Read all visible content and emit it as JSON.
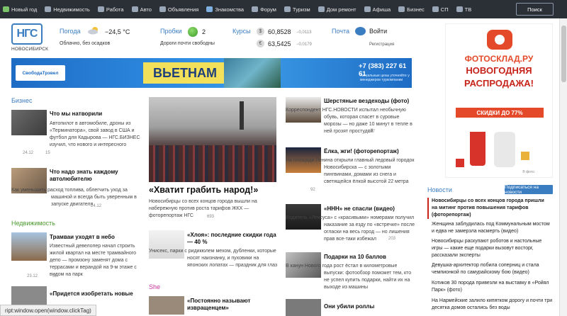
{
  "nav": [
    {
      "label": "Новый год",
      "icon": "tree-icon"
    },
    {
      "label": "Недвижимость",
      "icon": "house-icon"
    },
    {
      "label": "Работа",
      "icon": "briefcase-icon"
    },
    {
      "label": "Авто",
      "icon": "car-icon"
    },
    {
      "label": "Объявления",
      "icon": "list-icon"
    },
    {
      "label": "Знакомства",
      "icon": "heart-icon"
    },
    {
      "label": "Форум",
      "icon": "chat-icon"
    },
    {
      "label": "Туризм",
      "icon": "plane-icon"
    },
    {
      "label": "Дом ремонт",
      "icon": "tools-icon"
    },
    {
      "label": "Афиша",
      "icon": "ticket-icon"
    },
    {
      "label": "Бизнес",
      "icon": "chart-icon"
    },
    {
      "label": "СП",
      "icon": "cart-icon"
    },
    {
      "label": "ТВ",
      "icon": "tv-icon"
    }
  ],
  "search_label": "Поиск",
  "logo": {
    "text": "НГС",
    "city": "НОВОСИБИРСК"
  },
  "weather": {
    "label": "Погода",
    "temp": "−24,5 °С",
    "desc": "Облачно, без осадков"
  },
  "traffic": {
    "label": "Пробки",
    "score": "2",
    "desc": "Дороги почти свободны"
  },
  "rates": {
    "label": "Курсы",
    "usd": {
      "symbol": "$",
      "value": "60,8528",
      "change": "−0,0113"
    },
    "eur": {
      "symbol": "€",
      "value": "63,5425",
      "change": "−0,0179"
    }
  },
  "mail": {
    "label": "Почта",
    "login": "Войти",
    "register": "Регистрация"
  },
  "banner": {
    "logo": "СвободаТрэвел",
    "title": "ВЬЕТНАМ",
    "phone": "+7 (383) 227 61 61",
    "note": "Актуальные цены уточняйте у менеджеров туркомпании"
  },
  "side_ad": {
    "brand": "ФОТОСКЛАД.РУ",
    "line1": "НОВОГОДНЯЯ",
    "line2": "РАСПРОДАЖА!",
    "discount": "СКИДКИ ДО 77%",
    "note": "® фото"
  },
  "business": {
    "title": "Бизнес",
    "items": [
      {
        "title": "Что мы натворили",
        "text": "Автопилот в автомобиле, дроны из «Терминатора», свой завод в США и футбол для Кадырова — НГС.БИЗНЕС изучил, что нового и интересного Новосибирск создал за этот год",
        "date": "24.12",
        "count": "15"
      },
      {
        "title": "Что надо знать каждому автолюбителю",
        "text": "Как уменьшить расход топлива, облегчить уход за машиной и всегда быть уверенным в запуске двигателя",
        "date": "24.12",
        "count": ""
      }
    ]
  },
  "realty": {
    "title": "Недвижимость",
    "items": [
      {
        "title": "Трамваи уходят в небо",
        "text": "Известный девелопер начал строить жилой квартал на месте трамвайного депо — промзону заменят дома с террасами и верандой на 9-м этаже с видом на парк",
        "date": "23.12",
        "count": "55"
      },
      {
        "title": "«Придется изобретать новые",
        "text": "",
        "date": "",
        "count": ""
      }
    ]
  },
  "center": {
    "headline": "«Хватит грабить народ!»",
    "lead": "Новосибирцы со всех концов города вышли на набережную против роста тарифов ЖКХ — фоторепортаж НГС",
    "count": "693",
    "item2": {
      "title": "«Хлоя»: последние скидки года — 40 %",
      "text": "Унисекс, парки с ридикюлем мехом, дубленки, которые носят наизнанку, и пуховики на японских лопатах — праздник для глаз"
    },
    "she_title": "She",
    "item3": {
      "title": "«Постоянно называют извращенцем»"
    }
  },
  "right": {
    "items": [
      {
        "title": "Шерстяные вездеходы (фото)",
        "text": "Корреспондент НГС.НОВОСТИ испытал необычную обувь, которая спасет в суровые морозы — но даже 10 минут в тепле в ней грозят простудой",
        "count": "177"
      },
      {
        "title": "Ёлка, жги! (фоторепортаж)",
        "text": "На площади Ленина открыли главный ледовый городок Новосибирска — с золотыми пингвинами, домами из снега и светящейся ёлкой высотой 22 метра",
        "count": "92"
      },
      {
        "title": "«ННН» не спасли (видео)",
        "text": "Водитель «Лексуса» с «красивыми» номерами получил наказание за езду по «встречке» после огласки на весь город — но лишения прав все-таки избежал",
        "count": "203"
      },
      {
        "title": "Подарки на 10 баллов",
        "text": "В канун Нового года рост ёстал в километровые выпуски: фотообзор поможет тем, кто не успел купить подарки, найти их на выходе из машины",
        "count": ""
      },
      {
        "title": "Они убили роллы",
        "text": "",
        "count": ""
      }
    ]
  },
  "news": {
    "title": "Новости",
    "subscribe": "Подписаться на новости",
    "items": [
      "Новосибирцы со всех концов города пришли на митинг против повышения тарифов (фоторепортаж)",
      "Женщина заблудилась под Коммунальным мостом и едва не замерзла насмерть (видео)",
      "Новосибирцы раскупают роботов и настольные игры — какие еще подарки вызовут восторг, рассказали эксперты",
      "Девушка-архитектор побила соперниц и стала чемпионкой по самурайскому бою (видео)",
      "Котиков 30 порода привезли на выставку в «Ройял Парк» (фото)",
      "На Нармейские залило кипятком дорогу и почти три десятка домов остались без воды"
    ]
  },
  "statusbar": "ript:window.open(window.clickTag)"
}
